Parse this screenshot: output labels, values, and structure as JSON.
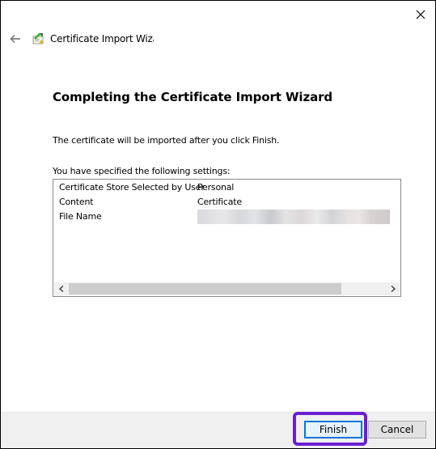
{
  "window": {
    "title": "Certificate Import Wizard",
    "close_icon": "close-icon"
  },
  "nav": {
    "back_icon": "back-arrow-icon",
    "app_icon": "certificate-icon"
  },
  "main": {
    "heading": "Completing the Certificate Import Wizard",
    "description": "The certificate will be imported after you click Finish.",
    "settings_label": "You have specified the following settings:",
    "settings": [
      {
        "key": "Certificate Store Selected by User",
        "value": "Personal"
      },
      {
        "key": "Content",
        "value": "Certificate"
      },
      {
        "key": "File Name",
        "value": ""
      }
    ]
  },
  "footer": {
    "finish_label": "Finish",
    "cancel_label": "Cancel"
  },
  "colors": {
    "accent": "#0078d7",
    "highlight": "#6a1fd0"
  }
}
